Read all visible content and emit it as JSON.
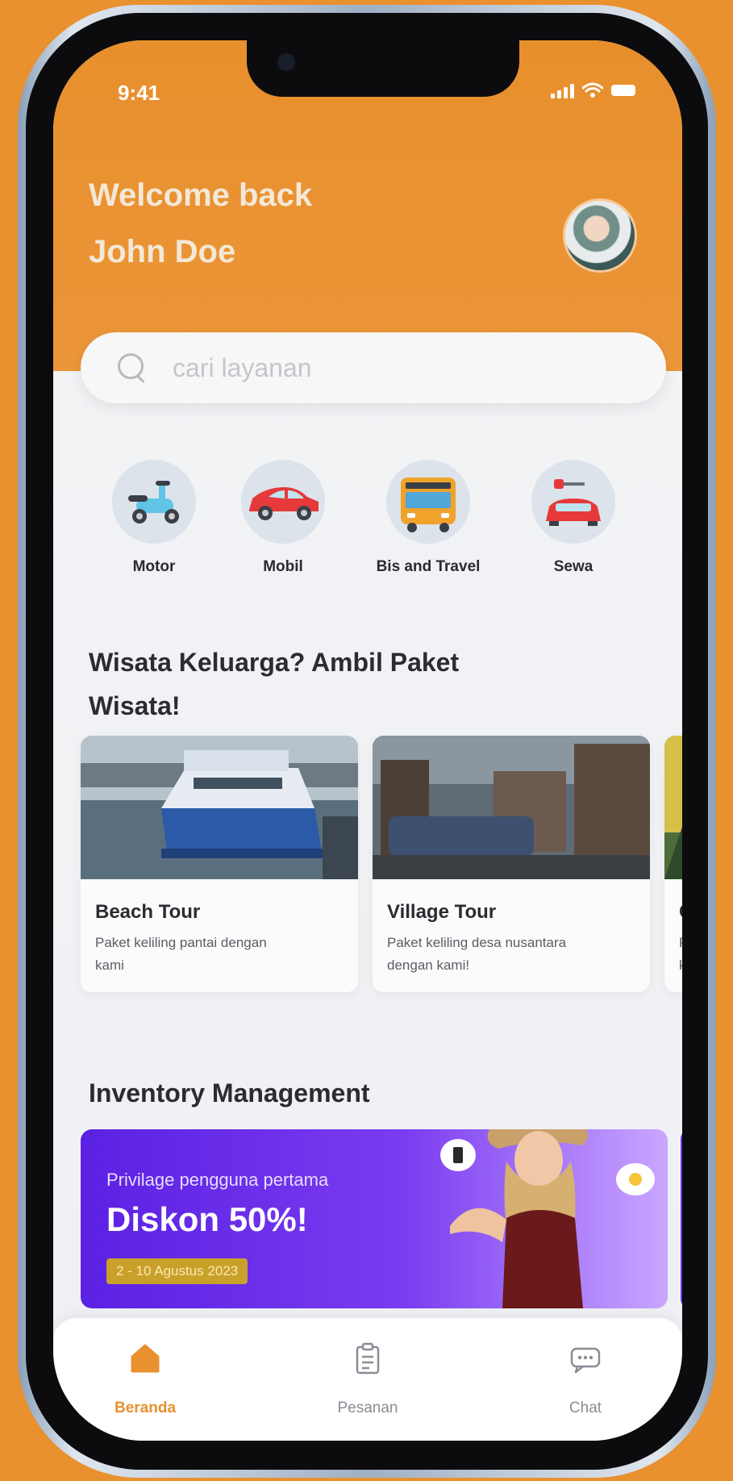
{
  "status_bar": {
    "time": "9:41"
  },
  "header": {
    "greeting": "Welcome back",
    "username": "John Doe"
  },
  "search": {
    "placeholder": "cari layanan"
  },
  "categories": [
    {
      "label": "Motor",
      "icon": "scooter-icon"
    },
    {
      "label": "Mobil",
      "icon": "car-icon"
    },
    {
      "label": "Bis and Travel",
      "icon": "bus-icon"
    },
    {
      "label": "Sewa",
      "icon": "rental-car-key-icon"
    }
  ],
  "packages_section": {
    "title_line1": "Wisata Keluarga? Ambil Paket",
    "title_line2": "Wisata!"
  },
  "tours": [
    {
      "name": "Beach Tour",
      "desc_line1": "Paket keliling pantai dengan",
      "desc_line2": "kami"
    },
    {
      "name": "Village Tour",
      "desc_line1": "Paket keliling desa nusantara",
      "desc_line2": "dengan kami!"
    },
    {
      "name": "Ci",
      "desc_line1": "Pa",
      "desc_line2": "ka"
    }
  ],
  "inventory_section": {
    "title": "Inventory Management"
  },
  "promo": {
    "subtitle": "Privilage pengguna pertama",
    "headline": "Diskon 50%!",
    "date": "2 - 10 Agustus 2023"
  },
  "bottom_nav": [
    {
      "label": "Beranda",
      "icon": "home-icon",
      "active": true
    },
    {
      "label": "Pesanan",
      "icon": "clipboard-icon",
      "active": false
    },
    {
      "label": "Chat",
      "icon": "chat-icon",
      "active": false
    }
  ],
  "colors": {
    "accent": "#e9902f",
    "promo": "#5b21e3",
    "text": "#2b2b30"
  }
}
